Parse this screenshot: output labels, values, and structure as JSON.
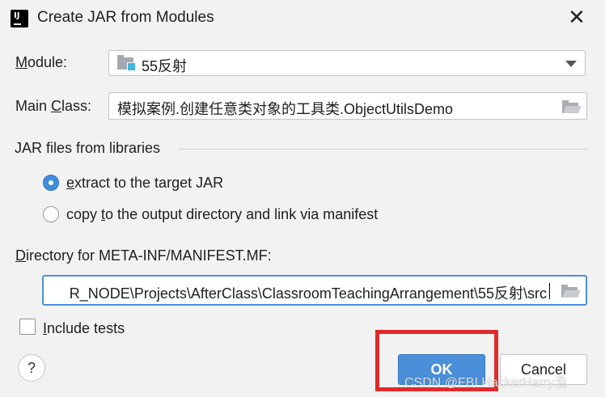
{
  "window": {
    "title": "Create JAR from Modules",
    "close_glyph": "✕",
    "app_icon_text": "IJ"
  },
  "module": {
    "label_prefix": "M",
    "label_rest": "odule:",
    "value": "55反射"
  },
  "main_class": {
    "label_prefix": "Main ",
    "label_underlined": "C",
    "label_rest": "lass:",
    "value": "模拟案例.创建任意类对象的工具类.ObjectUtilsDemo"
  },
  "libraries": {
    "section_title": "JAR files from libraries",
    "options": [
      {
        "underlined": "e",
        "rest": "xtract to the target JAR",
        "selected": true
      },
      {
        "prefix": "copy ",
        "underlined": "t",
        "rest": "o the output directory and link via manifest",
        "selected": false
      }
    ]
  },
  "manifest": {
    "label_underlined": "D",
    "label_rest": "irectory for META-INF/MANIFEST.MF:",
    "value": "R_NODE\\Projects\\AfterClass\\ClassroomTeachingArrangement\\55反射\\src"
  },
  "include_tests": {
    "underlined": "I",
    "rest": "nclude tests",
    "checked": false
  },
  "buttons": {
    "help": "?",
    "ok": "OK",
    "cancel": "Cancel"
  },
  "watermark": "CSDN @FBI HackerHarry浩",
  "colors": {
    "accent": "#4a8fd8",
    "highlight_box": "#e02b2b",
    "background": "#f2f2f2"
  }
}
